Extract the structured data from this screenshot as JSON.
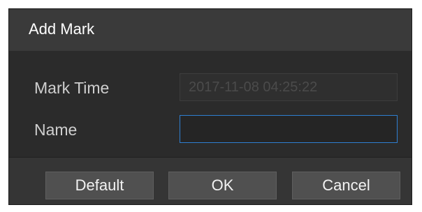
{
  "dialog": {
    "title": "Add Mark",
    "fields": {
      "mark_time_label": "Mark Time",
      "mark_time_value": "2017-11-08 04:25:22",
      "name_label": "Name",
      "name_value": ""
    },
    "buttons": {
      "default_label": "Default",
      "ok_label": "OK",
      "cancel_label": "Cancel"
    }
  },
  "colors": {
    "background": "#2b2b2b",
    "title_bar": "#3a3a3a",
    "input_focus_border": "#2f7fd1",
    "button": "#505050"
  }
}
